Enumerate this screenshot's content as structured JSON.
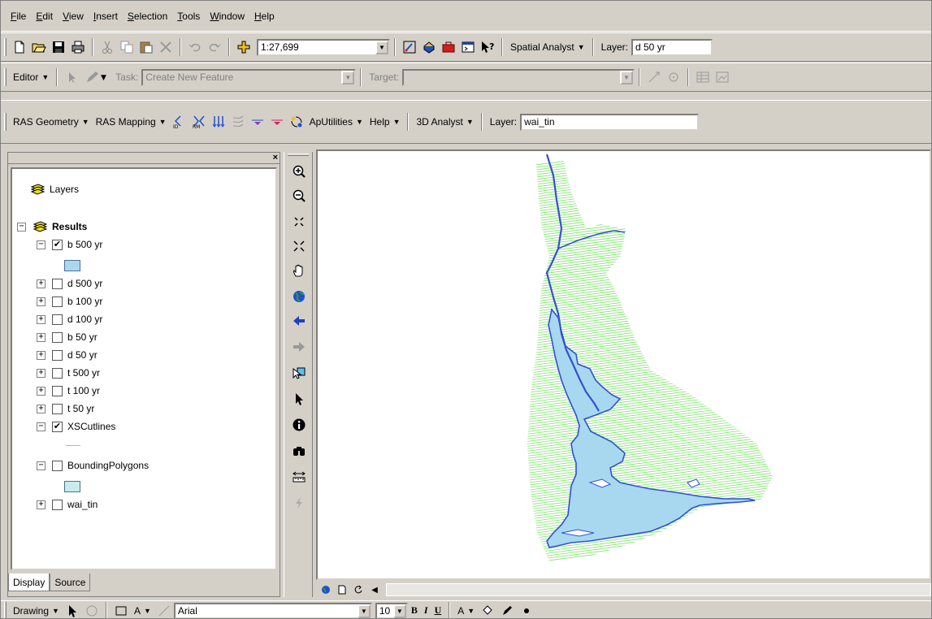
{
  "menu": [
    {
      "u": "F",
      "rest": "ile"
    },
    {
      "u": "E",
      "rest": "dit"
    },
    {
      "u": "V",
      "rest": "iew"
    },
    {
      "u": "I",
      "rest": "nsert"
    },
    {
      "u": "S",
      "rest": "election"
    },
    {
      "u": "T",
      "rest": "ools"
    },
    {
      "u": "W",
      "rest": "indow"
    },
    {
      "u": "H",
      "rest": "elp"
    }
  ],
  "standard_toolbar": {
    "scale": "1:27,699",
    "spatial_analyst": "Spatial Analyst",
    "layer_label": "Layer:",
    "layer_value": "d 50 yr"
  },
  "editor_toolbar": {
    "editor": "Editor",
    "task_label": "Task:",
    "task_value": "Create New Feature",
    "target_label": "Target:",
    "target_value": ""
  },
  "hec_toolbar": {
    "ras_geometry": "RAS Geometry",
    "ras_mapping": "RAS Mapping",
    "aputilities": "ApUtilities",
    "help": "Help",
    "analyst_3d": "3D Analyst",
    "layer_label": "Layer:",
    "layer_value": "wai_tin"
  },
  "toc": {
    "root": "Layers",
    "group": "Results",
    "layers": [
      {
        "name": "b 500 yr",
        "checked": true,
        "expanded": true
      },
      {
        "name": "d 500 yr",
        "checked": false,
        "expanded": false
      },
      {
        "name": "b 100 yr",
        "checked": false,
        "expanded": false
      },
      {
        "name": "d 100 yr",
        "checked": false,
        "expanded": false
      },
      {
        "name": "b 50 yr",
        "checked": false,
        "expanded": false
      },
      {
        "name": "d 50 yr",
        "checked": false,
        "expanded": false
      },
      {
        "name": "t 500 yr",
        "checked": false,
        "expanded": false
      },
      {
        "name": "t 100 yr",
        "checked": false,
        "expanded": false
      },
      {
        "name": "t 50 yr",
        "checked": false,
        "expanded": false
      },
      {
        "name": "XSCutlines",
        "checked": true,
        "expanded": true
      },
      {
        "name": "BoundingPolygons",
        "checked": false,
        "expanded": true
      },
      {
        "name": "wai_tin",
        "checked": false,
        "expanded": false
      }
    ],
    "tab_display": "Display",
    "tab_source": "Source"
  },
  "drawing_toolbar": {
    "drawing": "Drawing",
    "font": "Arial",
    "size": "10",
    "bold": "B",
    "italic": "I",
    "underline": "U",
    "font_color": "A"
  },
  "colors": {
    "flood_fill": "#a8d8f0",
    "flood_edge": "#2f50d8",
    "river": "#3550d0",
    "cutlines": "#7ee06a",
    "bounding": "#c8ecec"
  }
}
